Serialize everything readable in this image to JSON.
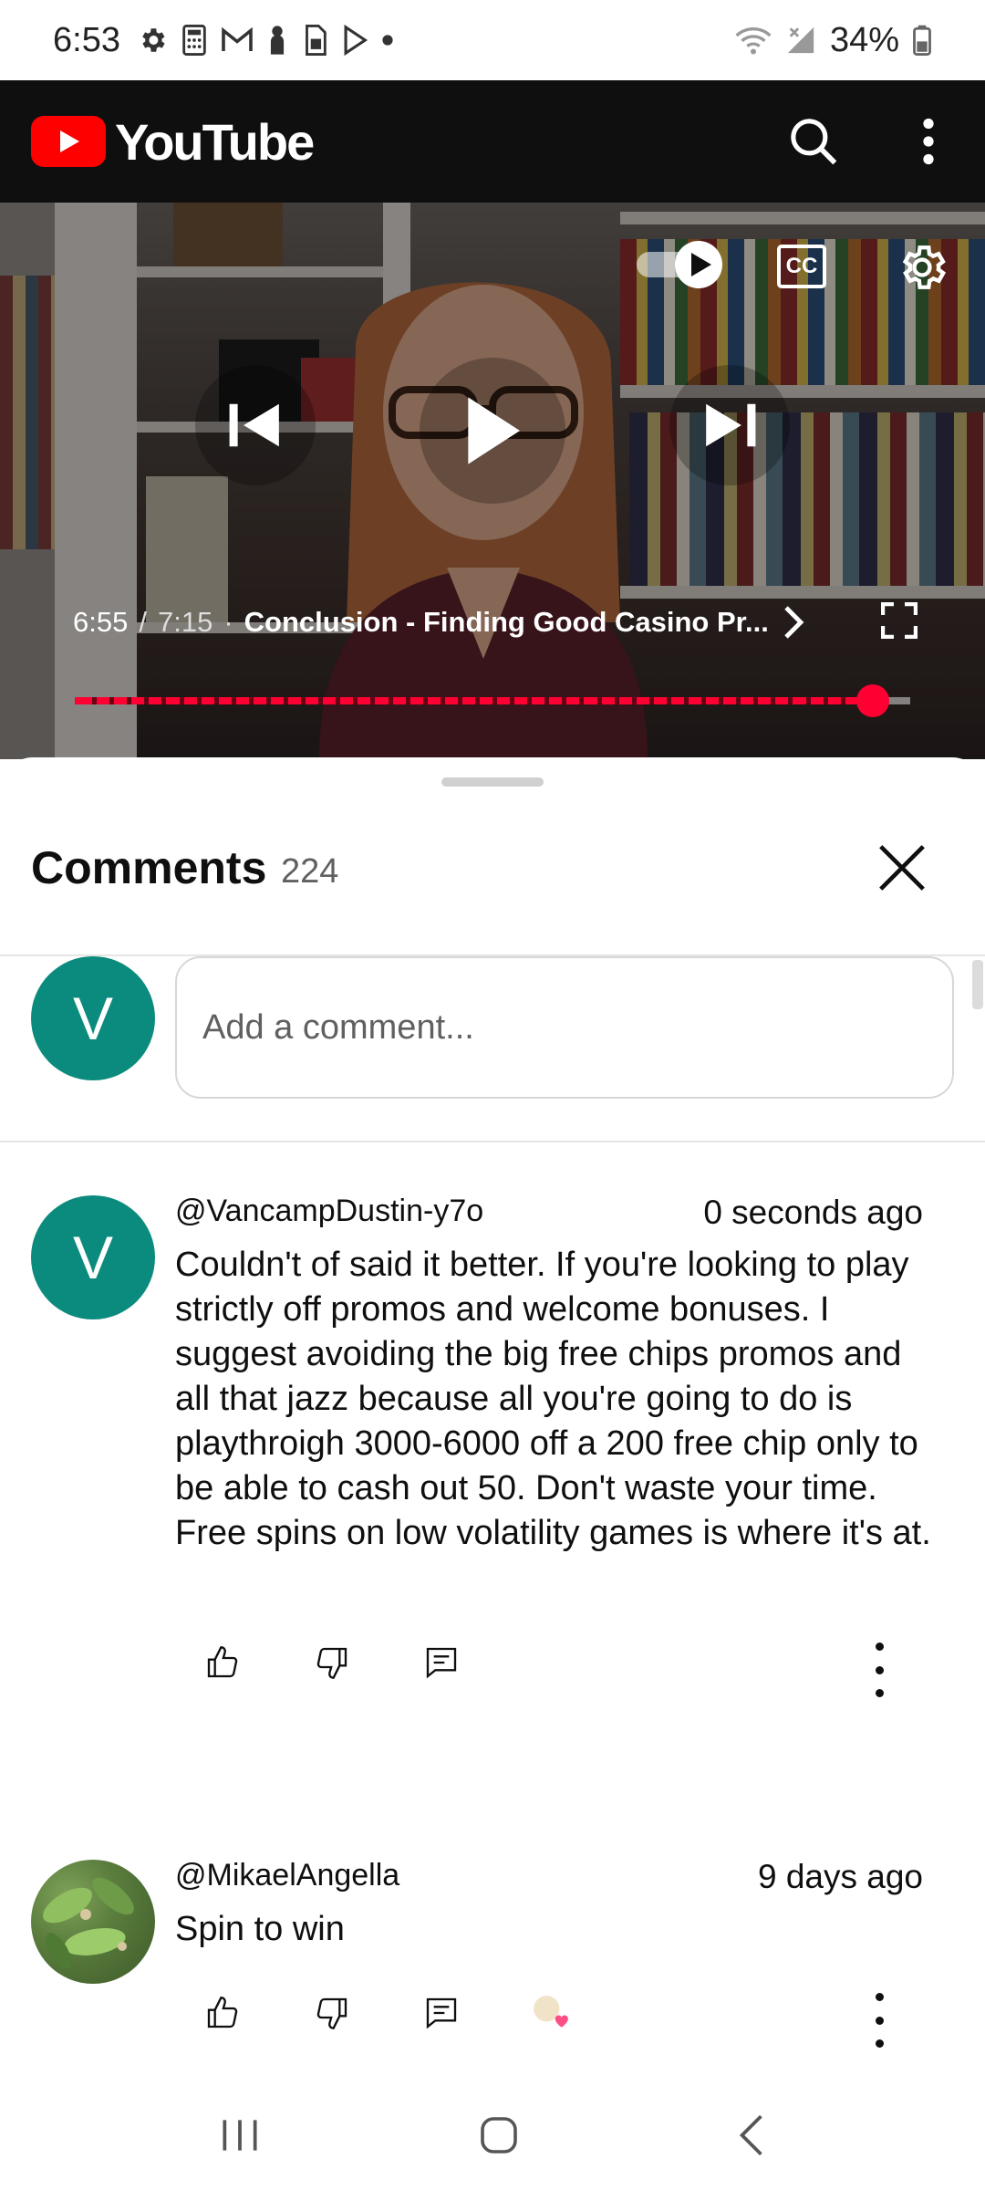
{
  "status_bar": {
    "time": "6:53",
    "battery": "34%"
  },
  "header": {
    "app_name": "YouTube"
  },
  "player": {
    "time_current": "6:55",
    "time_separator": "/",
    "time_total": "7:15",
    "chapter_dot": "·",
    "chapter_title": "Conclusion - Finding Good Casino Pr...",
    "cc_label": "CC",
    "progress_fraction": 0.955
  },
  "comments": {
    "title": "Comments",
    "count": "224",
    "input_placeholder": "Add a comment...",
    "user_initial": "V",
    "items": [
      {
        "avatar_initial": "V",
        "author": "@VancampDustin-y7o",
        "time": "0 seconds ago",
        "text": "Couldn't of said it better. If you're looking to play strictly off promos and welcome bonuses. I suggest avoiding the big free chips promos and all that jazz because all you're going to do is playthroigh 3000-6000 off a 200 free chip only to be able to cash out 50. Don't waste your time. Free spins on low volatility games is where it's at."
      },
      {
        "author": "@MikaelAngella",
        "time": "9 days ago",
        "text": "Spin to win"
      }
    ]
  },
  "colors": {
    "accent_red": "#ff0033",
    "avatar_teal": "#0b8b7d",
    "header_bg": "#0f0f0f"
  }
}
